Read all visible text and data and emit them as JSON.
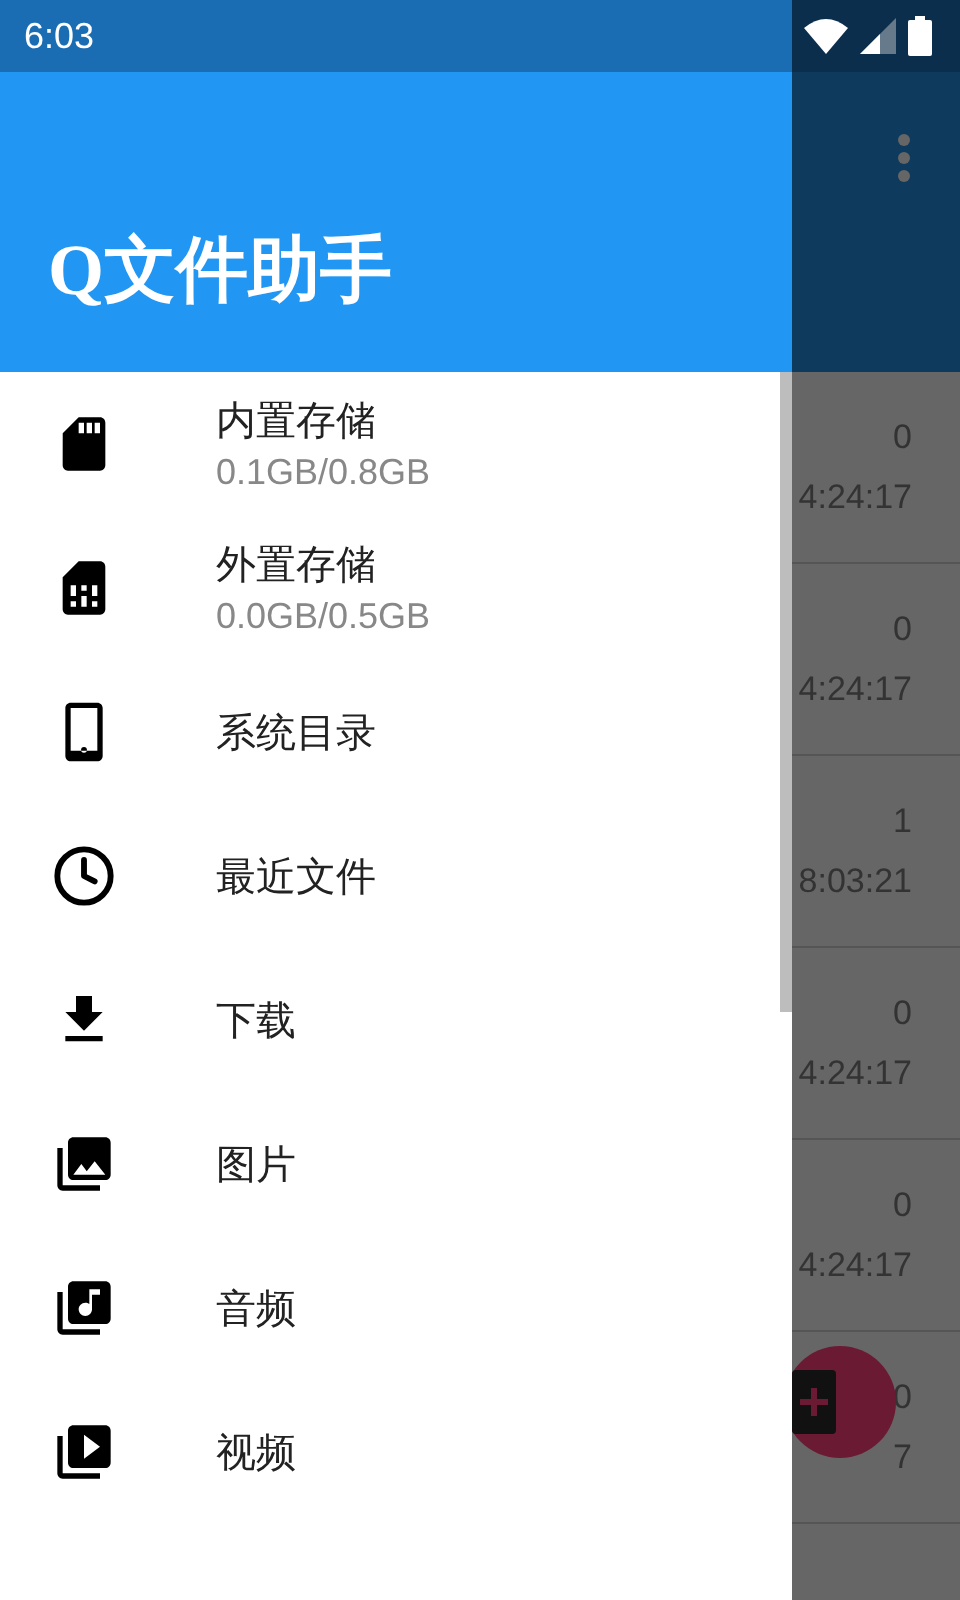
{
  "status_bar": {
    "time": "6:03"
  },
  "drawer": {
    "title": "Q文件助手",
    "items": [
      {
        "label": "内置存储",
        "detail": "0.1GB/0.8GB"
      },
      {
        "label": "外置存储",
        "detail": "0.0GB/0.5GB"
      },
      {
        "label": "系统目录"
      },
      {
        "label": "最近文件"
      },
      {
        "label": "下载"
      },
      {
        "label": "图片"
      },
      {
        "label": "音频"
      },
      {
        "label": "视频"
      }
    ]
  },
  "background_list": [
    {
      "column_1": "0",
      "column_2": "4:24:17"
    },
    {
      "column_1": "0",
      "column_2": "4:24:17"
    },
    {
      "column_1": "1",
      "column_2": "8:03:21"
    },
    {
      "column_1": "0",
      "column_2": "4:24:17"
    },
    {
      "column_1": "0",
      "column_2": "4:24:17"
    },
    {
      "column_1": "0",
      "column_2": "7"
    }
  ]
}
